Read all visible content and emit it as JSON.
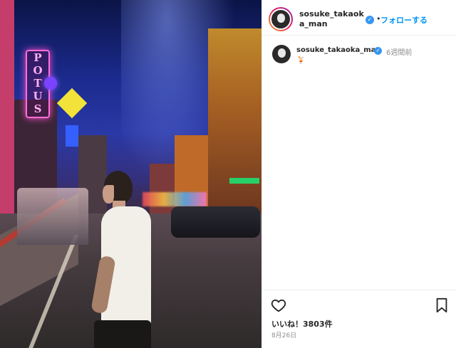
{
  "photo": {
    "sign_text": [
      "P",
      "O",
      "T",
      "U",
      "S"
    ],
    "description_icon": "street-photo"
  },
  "header": {
    "username": "sosuke_takaoka_man",
    "verified_icon": "verified-badge-icon",
    "separator": "•",
    "follow_label": "フォローする"
  },
  "caption": {
    "username": "sosuke_takaoka_man",
    "timestamp": "6週間前",
    "text": "🍹"
  },
  "actions": {
    "like_icon": "heart-icon",
    "save_icon": "bookmark-icon",
    "likes_text": "いいね！3803件",
    "date_text": "8月26日"
  },
  "colors": {
    "link_blue": "#0095f6",
    "verified_blue": "#3897f0",
    "muted_gray": "#8e8e8e"
  }
}
